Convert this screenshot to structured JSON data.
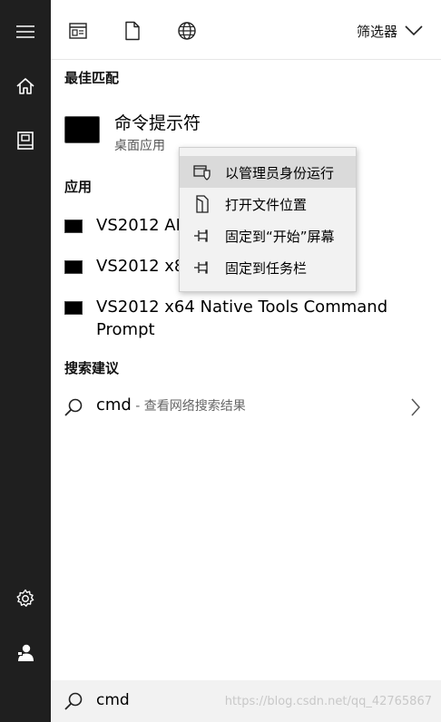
{
  "rail": {
    "items": [
      {
        "name": "hamburger-menu",
        "icon": "menu-icon"
      },
      {
        "name": "home",
        "icon": "home-icon"
      },
      {
        "name": "documents",
        "icon": "book-icon"
      },
      {
        "name": "settings",
        "icon": "gear-icon"
      },
      {
        "name": "account",
        "icon": "user-icon"
      }
    ]
  },
  "topbar": {
    "tabs": [
      {
        "name": "apps",
        "icon": "apps-window-icon"
      },
      {
        "name": "documents",
        "icon": "document-icon"
      },
      {
        "name": "web",
        "icon": "globe-icon"
      }
    ],
    "filter_label": "筛选器"
  },
  "best_match": {
    "title": "最佳匹配",
    "app_name": "命令提示符",
    "app_type": "桌面应用"
  },
  "apps": {
    "title": "应用",
    "items": [
      {
        "label": "VS2012 AI"
      },
      {
        "label": "VS2012 x8"
      },
      {
        "label": "VS2012 x64 Native Tools Command Prompt"
      }
    ]
  },
  "suggestions": {
    "title": "搜索建议",
    "query": "cmd",
    "hint": " - 查看网络搜索结果"
  },
  "context_menu": {
    "items": [
      {
        "label": "以管理员身份运行",
        "icon": "admin-shield-icon",
        "hover": true
      },
      {
        "label": "打开文件位置",
        "icon": "file-location-icon",
        "hover": false
      },
      {
        "label": "固定到“开始”屏幕",
        "icon": "pin-icon",
        "hover": false
      },
      {
        "label": "固定到任务栏",
        "icon": "pin-icon",
        "hover": false
      }
    ]
  },
  "search_box": {
    "value": "cmd",
    "watermark": "https://blog.csdn.net/qq_42765867"
  },
  "colors": {
    "rail_bg": "#1f1f1f",
    "menu_bg": "#f2f2f2",
    "menu_hover": "#dadada",
    "search_bg": "#f2f2f2"
  }
}
